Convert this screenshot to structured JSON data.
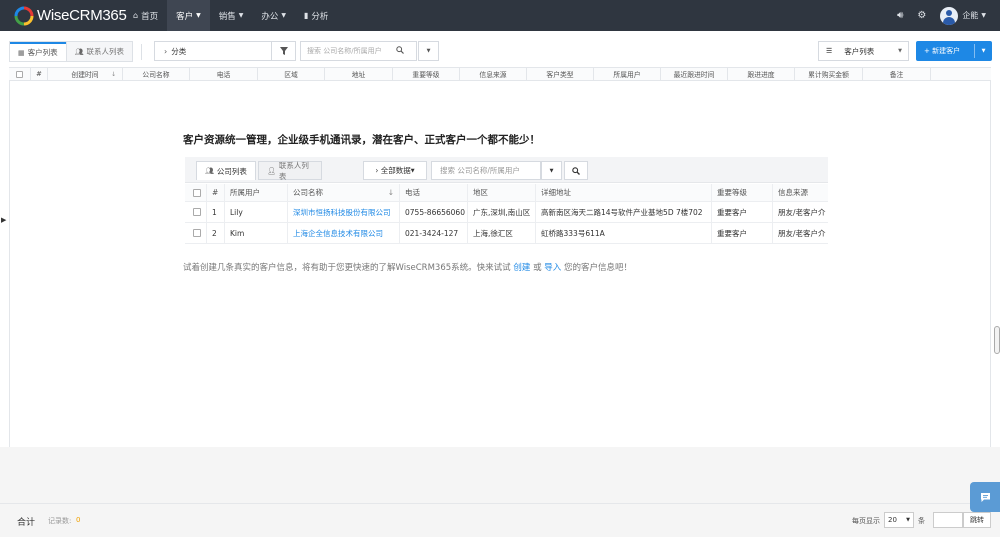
{
  "app": {
    "logo_text": "WiseCRM365",
    "nav": [
      {
        "label": "首页",
        "icon": "home-icon"
      },
      {
        "label": "客户",
        "icon": "",
        "active": true
      },
      {
        "label": "销售",
        "icon": ""
      },
      {
        "label": "办公",
        "icon": ""
      },
      {
        "label": "分析",
        "icon": "bar-chart-icon"
      }
    ],
    "user_name": "企能"
  },
  "toolbar": {
    "tabs": [
      "客户列表",
      "联系人列表"
    ],
    "category_label": "分类",
    "search_placeholder": "搜索 公司名称/所属用户",
    "view_select": "客户列表",
    "new_button": "+ 新建客户"
  },
  "table": {
    "columns": [
      "#",
      "创建时间",
      "公司名称",
      "电话",
      "区域",
      "地址",
      "重要等级",
      "信息来源",
      "客户类型",
      "所属用户",
      "最近跟进时间",
      "跟进进度",
      "累计购买金额",
      "备注"
    ]
  },
  "empty_state": {
    "headline": "客户资源统一管理，企业级手机通讯录，潜在客户、正式客户一个都不能少！",
    "preview": {
      "tabs": [
        "公司列表",
        "联系人列表"
      ],
      "filter_button": "全部数据",
      "search_placeholder": "搜索 公司名称/所属用户",
      "columns": [
        "#",
        "所属用户",
        "公司名称",
        "电话",
        "地区",
        "详细地址",
        "重要等级",
        "信息来源"
      ],
      "rows": [
        {
          "num": "1",
          "user": "Lily",
          "company": "深圳市恒扬科技股份有限公司",
          "phone": "0755-86656060",
          "region": "广东,深圳,南山区",
          "address": "高新南区海天二路14号软件产业基地5D 7楼702",
          "level": "重要客户",
          "source": "朋友/老客户介"
        },
        {
          "num": "2",
          "user": "Kim",
          "company": "上海企全信息技术有限公司",
          "phone": "021-3424-127",
          "region": "上海,徐汇区",
          "address": "虹桥路333号611A",
          "level": "重要客户",
          "source": "朋友/老客户介"
        }
      ]
    },
    "helper_prefix": "试着创建几条真实的客户信息，将有助于您更快速的了解WiseCRM365系统。快来试试",
    "helper_create": "创建",
    "helper_or": "或",
    "helper_import": "导入",
    "helper_suffix": "您的客户信息吧！"
  },
  "footer": {
    "total_label": "合计",
    "count_label": "记录数:",
    "count_value": "0",
    "per_page_label": "每页显示",
    "per_page_value": "20",
    "unit_label": "条",
    "jump_label": "跳转"
  },
  "colors": {
    "nav_bg": "#2f3640",
    "accent": "#1e88e5",
    "float_btn": "#5b9bd5"
  }
}
